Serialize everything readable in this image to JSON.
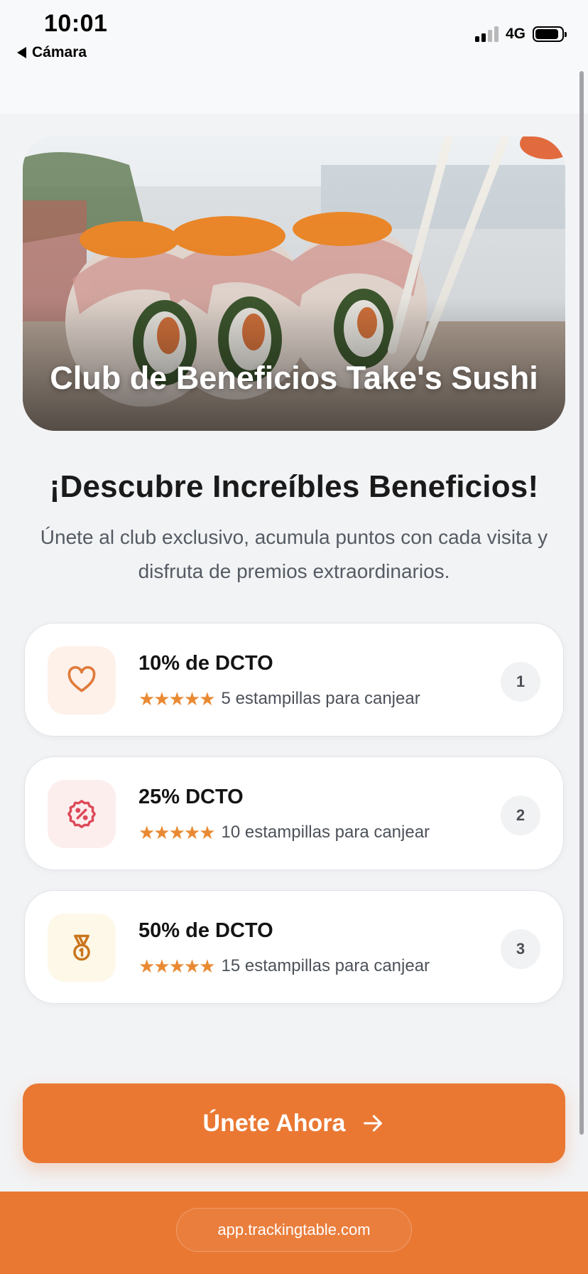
{
  "status_bar": {
    "time": "10:01",
    "back_label": "Cámara",
    "network": "4G"
  },
  "hero": {
    "title": "Club de Beneficios Take's Sushi"
  },
  "headline": "¡Descubre Increíbles Beneficios!",
  "subtext": "Únete al club exclusivo, acumula puntos con cada visita y disfruta de premios extraordinarios.",
  "benefits": [
    {
      "title": "10% de DCTO",
      "stars": "★★★★★",
      "subtitle": "5 estampillas para canjear",
      "number": "1",
      "icon": "heart-icon",
      "icon_bg": "#fdf1ea",
      "icon_color": "#e07b3c"
    },
    {
      "title": "25% DCTO",
      "stars": "★★★★★",
      "subtitle": "10 estampillas para canjear",
      "number": "2",
      "icon": "discount-badge-icon",
      "icon_bg": "#fdeeee",
      "icon_color": "#dc4a58"
    },
    {
      "title": "50% de DCTO",
      "stars": "★★★★★",
      "subtitle": "15 estampillas para canjear",
      "number": "3",
      "icon": "medal-icon",
      "icon_bg": "#fdf8e8",
      "icon_color": "#c9761f"
    }
  ],
  "cta": {
    "label": "Únete Ahora"
  },
  "footer": {
    "url": "app.trackingtable.com"
  },
  "colors": {
    "accent": "#ea7833",
    "star": "#e98a33"
  }
}
